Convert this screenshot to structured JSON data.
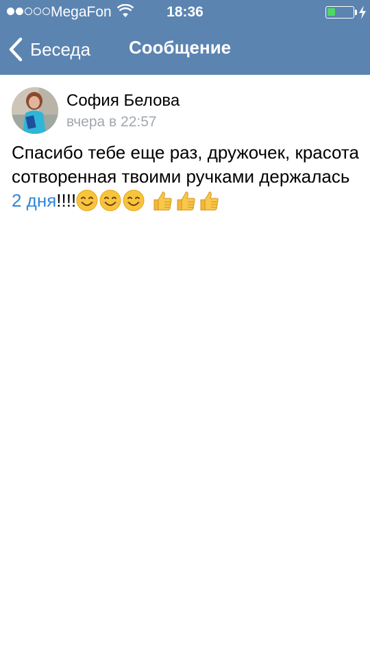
{
  "status_bar": {
    "carrier": "MegaFon",
    "time": "18:36",
    "signal_bars_filled": 2,
    "signal_bars_total": 5,
    "battery_level": 0.3,
    "battery_color": "#4cd964"
  },
  "nav": {
    "back_label": "Беседа",
    "title": "Сообщение",
    "bar_color": "#5b84b1"
  },
  "message": {
    "author": "София Белова",
    "timestamp": "вчера в 22:57",
    "text_before_link": "Спасибо тебе еще раз, дружочек, красота сотворенная твоими ручками держалась ",
    "link_text": "2 дня",
    "text_after_link": "!!!!",
    "emoji_group_1": [
      "smiling-face-emoji",
      "smiling-face-emoji",
      "smiling-face-emoji"
    ],
    "emoji_group_2": [
      "thumbs-up-emoji",
      "thumbs-up-emoji",
      "thumbs-up-emoji"
    ],
    "link_color": "#2f86d8"
  }
}
